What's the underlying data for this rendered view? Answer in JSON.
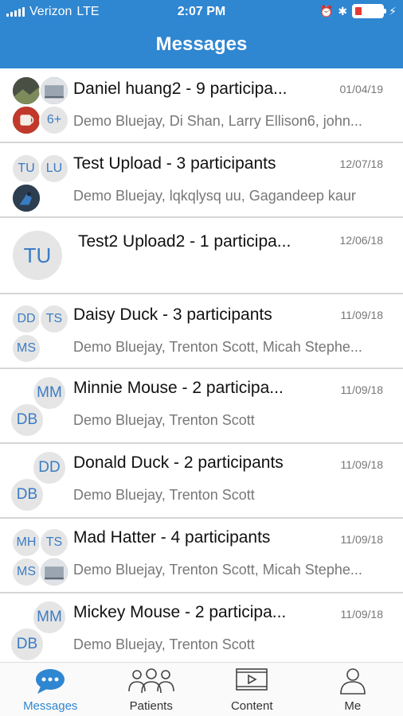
{
  "status_bar": {
    "carrier": "Verizon",
    "network": "LTE",
    "time": "2:07 PM"
  },
  "header": {
    "title": "Messages"
  },
  "conversations": [
    {
      "title": "Daniel huang2 - 9 participa...",
      "date": "01/04/19",
      "participants": "Demo Bluejay, Di Shan, Larry Ellison6, john...",
      "avatars": [
        "photo",
        "photo",
        "photo",
        "6+"
      ]
    },
    {
      "title": "Test Upload - 3 participants",
      "date": "12/07/18",
      "participants": "Demo Bluejay, lqkqlysq uu, Gagandeep kaur",
      "avatars": [
        "TU",
        "LU",
        "photo"
      ]
    },
    {
      "title": "Test2 Upload2 - 1 participa...",
      "date": "12/06/18",
      "participants": "",
      "avatars": [
        "TU"
      ]
    },
    {
      "title": "Daisy Duck - 3 participants",
      "date": "11/09/18",
      "participants": "Demo Bluejay, Trenton Scott, Micah Stephe...",
      "avatars": [
        "DD",
        "TS",
        "MS"
      ]
    },
    {
      "title": "Minnie Mouse - 2 participa...",
      "date": "11/09/18",
      "participants": "Demo Bluejay, Trenton Scott",
      "avatars": [
        "MM",
        "DB"
      ]
    },
    {
      "title": "Donald Duck - 2 participants",
      "date": "11/09/18",
      "participants": "Demo Bluejay, Trenton Scott",
      "avatars": [
        "DD",
        "DB"
      ]
    },
    {
      "title": "Mad Hatter - 4 participants",
      "date": "11/09/18",
      "participants": "Demo Bluejay, Trenton Scott, Micah Stephe...",
      "avatars": [
        "MH",
        "TS",
        "MS",
        "photo"
      ]
    },
    {
      "title": "Mickey Mouse - 2 participa...",
      "date": "11/09/18",
      "participants": "Demo Bluejay, Trenton Scott",
      "avatars": [
        "MM",
        "DB"
      ]
    }
  ],
  "tabs": [
    {
      "label": "Messages",
      "icon": "chat-bubble-icon",
      "active": true
    },
    {
      "label": "Patients",
      "icon": "people-group-icon",
      "active": false
    },
    {
      "label": "Content",
      "icon": "video-screen-icon",
      "active": false
    },
    {
      "label": "Me",
      "icon": "person-icon",
      "active": false
    }
  ],
  "colors": {
    "brand": "#2f86d1",
    "avatar_text": "#3a7cc4",
    "avatar_bg": "#e5e5e5"
  }
}
